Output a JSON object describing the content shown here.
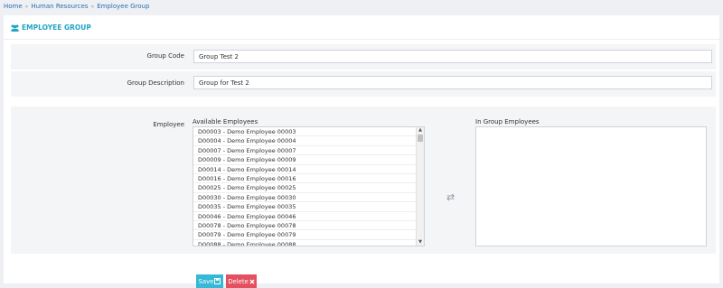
{
  "breadcrumb": {
    "home": "Home",
    "section": "Human Resources",
    "current": "Employee Group",
    "separator": "»"
  },
  "header": {
    "title": "EMPLOYEE GROUP",
    "icon": "users-icon"
  },
  "form": {
    "group_code": {
      "label": "Group Code",
      "value": "Group Test 2"
    },
    "group_description": {
      "label": "Group Description",
      "value": "Group for Test 2"
    },
    "employee": {
      "label": "Employee",
      "available_caption": "Available Employees",
      "in_group_caption": "In Group Employees",
      "available": [
        "D00003 - Demo Employee 00003",
        "D00004 - Demo Employee 00004",
        "D00007 - Demo Employee 00007",
        "D00009 - Demo Employee 00009",
        "D00014 - Demo Employee 00014",
        "D00016 - Demo Employee 00016",
        "D00025 - Demo Employee 00025",
        "D00030 - Demo Employee 00030",
        "D00035 - Demo Employee 00035",
        "D00046 - Demo Employee 00046",
        "D00078 - Demo Employee 00078",
        "D00079 - Demo Employee 00079",
        "D00088 - Demo Employee 00088"
      ],
      "in_group": [],
      "transfer_icon": "transfer-arrows-icon"
    }
  },
  "actions": {
    "save_label": "Save",
    "save_icon": "save-icon",
    "delete_label": "Delete",
    "delete_icon": "delete-x-icon"
  },
  "colors": {
    "accent": "#24a5c4",
    "save": "#35b9d6",
    "delete": "#e4505f",
    "link": "#2a6fae"
  }
}
